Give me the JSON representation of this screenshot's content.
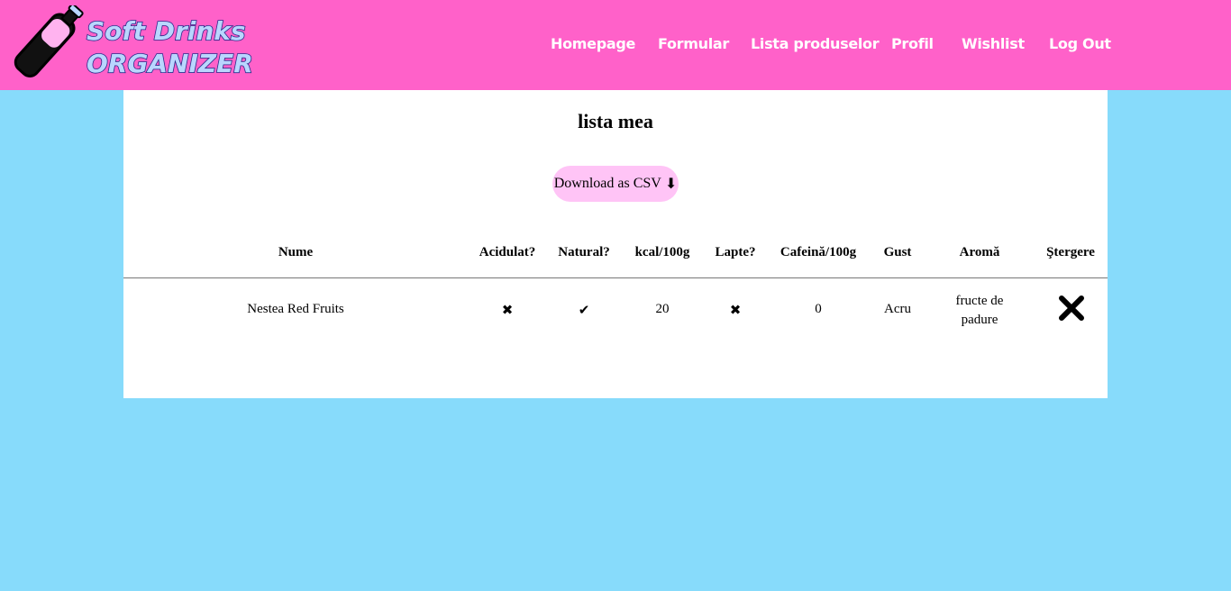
{
  "header": {
    "logo": {
      "line1": "Soft Drinks",
      "line2": "ORGANIZER",
      "icon": "bottle-icon"
    },
    "nav": [
      "Homepage",
      "Formular",
      "Lista produselor",
      "Profil",
      "Wishlist",
      "Log Out"
    ]
  },
  "main": {
    "title": "lista mea",
    "download_label": "Download as CSV",
    "download_icon": "⬇",
    "table": {
      "headers": [
        "Nume",
        "Acidulat?",
        "Natural?",
        "kcal/100g",
        "Lapte?",
        "Cafeină/100g",
        "Gust",
        "Aromă",
        "Ştergere"
      ],
      "rows": [
        {
          "name": "Nestea Red Fruits",
          "acidulat": "✖",
          "natural": "✔",
          "kcal": "20",
          "lapte": "✖",
          "cafeina": "0",
          "gust": "Acru",
          "aroma": "fructe de padure",
          "delete_icon": "delete-x-icon"
        }
      ]
    }
  },
  "colors": {
    "header_bg": "#ff61c9",
    "page_bg": "#87dbfb",
    "button_bg": "#ffc4f6",
    "logo_text": "#b9d6ff"
  }
}
